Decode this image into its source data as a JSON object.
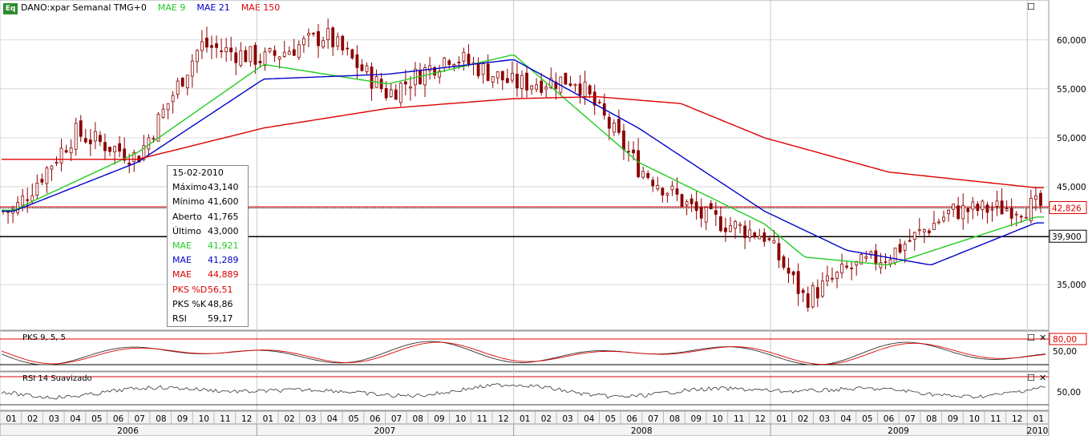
{
  "header": {
    "logo": "Eq",
    "symbol": "DANO:xpar Semanal TMG+0",
    "mae9": "MAE 9",
    "mae21": "MAE 21",
    "mae150": "MAE 150"
  },
  "tooltip": {
    "date": "15-02-2010",
    "rows": [
      {
        "label": "Máximo",
        "value": "43,140",
        "color": "#000000"
      },
      {
        "label": "Mínimo",
        "value": "41,600",
        "color": "#000000"
      },
      {
        "label": "Aberto",
        "value": "41,765",
        "color": "#000000"
      },
      {
        "label": "Último",
        "value": "43,000",
        "color": "#000000"
      },
      {
        "label": "MAE",
        "value": "41,921",
        "color": "#22cc22"
      },
      {
        "label": "MAE",
        "value": "41,289",
        "color": "#0000cc"
      },
      {
        "label": "MAE",
        "value": "44,889",
        "color": "#dd0000"
      },
      {
        "label": "PKS %D",
        "value": "56,51",
        "color": "#dd0000"
      },
      {
        "label": "PKS %K",
        "value": "48,86",
        "color": "#000000"
      },
      {
        "label": "RSI",
        "value": "59,17",
        "color": "#000000"
      }
    ]
  },
  "panels": {
    "pks_label": "PKS 9, 5, 5",
    "rsi_label": "RSI 14 Suavizado"
  },
  "colors": {
    "candle": "#8b0000",
    "mae9": "#22cc22",
    "mae21": "#0000cc",
    "mae150": "#dd0000",
    "grid": "#c8c8c8"
  },
  "chart_data": {
    "type": "line",
    "series": [
      {
        "name": "MAE 9",
        "x": [
          "2006-01",
          "2006-07",
          "2007-01",
          "2007-07",
          "2008-01",
          "2008-07",
          "2009-01",
          "2009-03",
          "2009-07",
          "2010-02"
        ],
        "values": [
          42.6,
          48.5,
          57.5,
          55.5,
          58.5,
          47.5,
          41.2,
          37.8,
          37.0,
          41.9
        ]
      },
      {
        "name": "MAE 21",
        "x": [
          "2006-01",
          "2006-07",
          "2007-01",
          "2007-07",
          "2008-01",
          "2008-07",
          "2009-01",
          "2009-05",
          "2009-09",
          "2010-02"
        ],
        "values": [
          42.5,
          47.5,
          56.0,
          56.5,
          58.0,
          51.0,
          42.5,
          38.5,
          37.0,
          41.3
        ]
      },
      {
        "name": "MAE 150",
        "x": [
          "2006-01",
          "2006-07",
          "2007-01",
          "2007-07",
          "2008-01",
          "2008-05",
          "2008-09",
          "2009-01",
          "2009-07",
          "2010-02"
        ],
        "values": [
          47.8,
          47.8,
          51.0,
          53.0,
          54.0,
          54.2,
          53.5,
          50.0,
          46.5,
          44.9
        ]
      }
    ],
    "candles_approx_close": {
      "x": [
        "2006-01",
        "2006-04",
        "2006-07",
        "2006-10",
        "2007-01",
        "2007-04",
        "2007-07",
        "2007-10",
        "2008-01",
        "2008-04",
        "2008-07",
        "2008-10",
        "2009-01",
        "2009-03",
        "2009-05",
        "2009-07",
        "2009-10",
        "2010-02"
      ],
      "values": [
        42.5,
        50.5,
        48.0,
        59.5,
        58.0,
        60.5,
        54.5,
        58.5,
        55.5,
        56.0,
        47.0,
        42.0,
        40.0,
        33.5,
        36.5,
        38.0,
        42.5,
        43.0
      ]
    },
    "price_axis_ticks": [
      "60,000",
      "55,000",
      "50,000",
      "45,000",
      "35,000"
    ],
    "price_levels": [
      {
        "label": "42,826",
        "value": 42.826,
        "color": "#dd0000"
      },
      {
        "label": "39,900",
        "value": 39.9,
        "color": "#000000"
      }
    ],
    "pks_ticks": [
      {
        "label": "80,00",
        "color": "#dd0000"
      },
      {
        "label": "50,00",
        "color": "#000000"
      }
    ],
    "rsi_ticks": [
      {
        "label": "50,00",
        "color": "#000000"
      }
    ],
    "x_month_labels": [
      "01",
      "02",
      "03",
      "04",
      "05",
      "06",
      "07",
      "08",
      "09",
      "10",
      "11",
      "12",
      "01",
      "02",
      "03",
      "04",
      "05",
      "06",
      "07",
      "08",
      "09",
      "10",
      "11",
      "12",
      "01",
      "02",
      "03",
      "04",
      "05",
      "06",
      "07",
      "08",
      "09",
      "10",
      "11",
      "12",
      "01",
      "02",
      "03",
      "04",
      "05",
      "06",
      "07",
      "08",
      "09",
      "10",
      "11",
      "12",
      "01"
    ],
    "x_year_labels": [
      "2006",
      "2007",
      "2008",
      "2009",
      "2010"
    ],
    "ylim": [
      30.5,
      64.0
    ],
    "grid": true
  }
}
